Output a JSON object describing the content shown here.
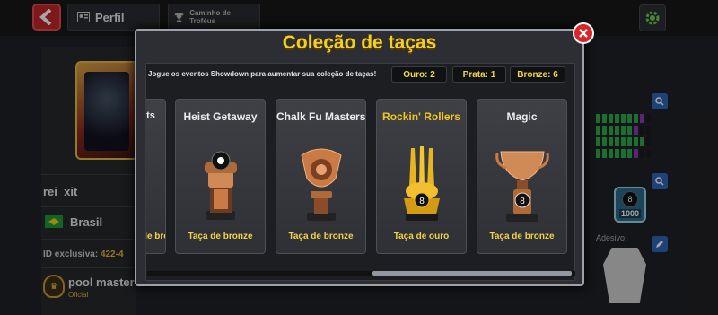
{
  "header": {
    "tabs": [
      {
        "label": "Perfil",
        "icon": "profile-card-icon"
      },
      {
        "label": "Caminho de Troféus",
        "icon": "trophy-icon"
      }
    ]
  },
  "profile": {
    "username": "rei_xit",
    "country": "Brasil",
    "id_label": "ID exclusiva:",
    "id_value": "422-4",
    "clan_name": "pool master",
    "clan_role": "Oficial",
    "sticker_label": "Adesivo:",
    "badge_value": "1000"
  },
  "modal": {
    "title": "Coleção de taças",
    "intro": "Jogue os eventos Showdown para aumentar sua coleção de taças!",
    "counts": {
      "gold": "Ouro: 2",
      "silver": "Prata: 1",
      "bronze": "Bronze: 6"
    },
    "partial_card": {
      "title": "sts",
      "subtitle": "Taça de bronze"
    },
    "cards": [
      {
        "title": "Heist Getaway",
        "subtitle": "Taça de bronze",
        "tier": "bronze",
        "highlight": false
      },
      {
        "title": "Chalk Fu Masters",
        "subtitle": "Taça de bronze",
        "tier": "bronze",
        "highlight": false
      },
      {
        "title": "Rockin' Rollers",
        "subtitle": "Taça de ouro",
        "tier": "gold",
        "highlight": true
      },
      {
        "title": "Magic",
        "subtitle": "Taça de bronze",
        "tier": "bronze",
        "highlight": false
      }
    ]
  },
  "colors": {
    "title_gold": "#f5cf1c",
    "bronze": "#c97a45",
    "gold": "#e8b520",
    "close_red": "#d7262b"
  }
}
